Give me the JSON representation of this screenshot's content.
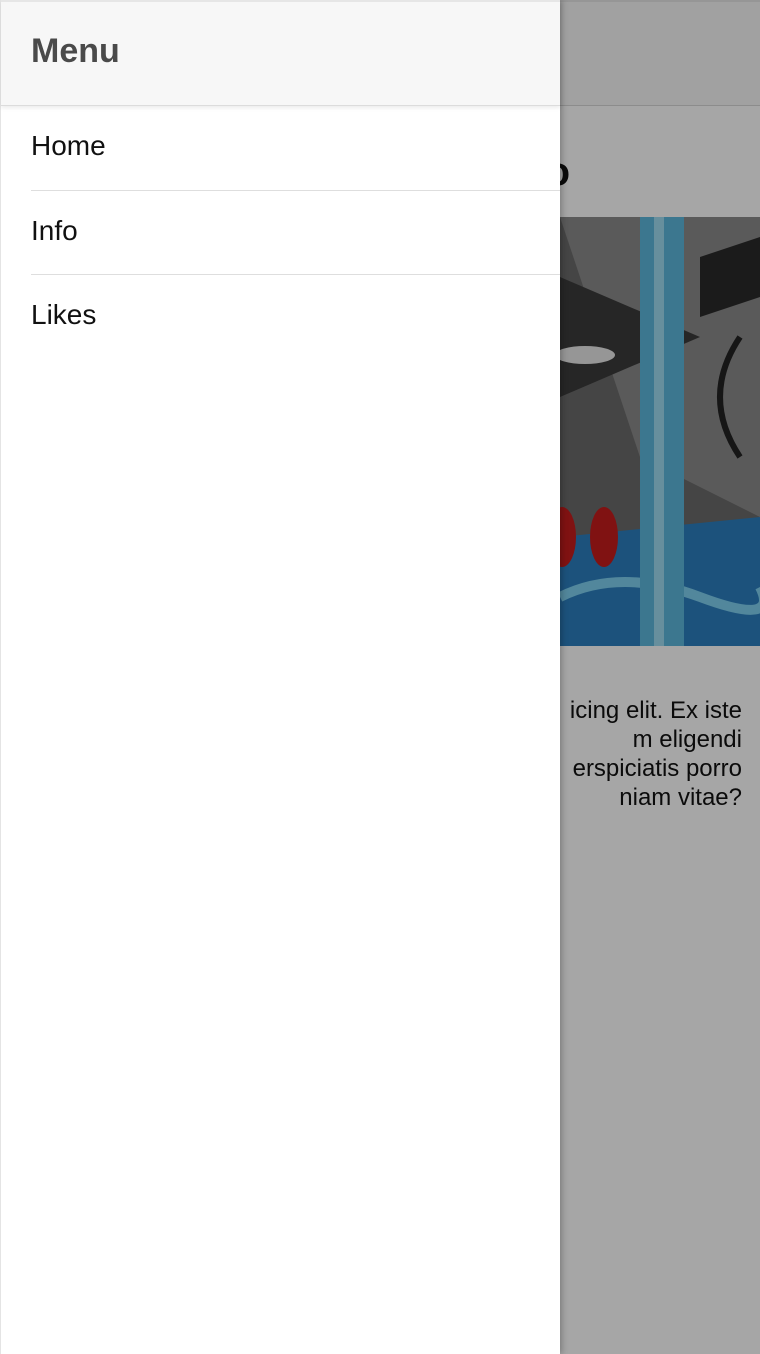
{
  "drawer": {
    "title": "Menu",
    "items": [
      {
        "label": "Home"
      },
      {
        "label": "Info"
      },
      {
        "label": "Likes"
      }
    ]
  },
  "page": {
    "title_fragment": "o",
    "body_lines": [
      "icing elit. Ex iste",
      "m eligendi",
      "erspiciatis porro",
      "niam vitae?"
    ]
  },
  "colors": {
    "header_bg": "#f7f7f7",
    "scrim": "rgba(0,0,0,0.35)",
    "text": "#111111",
    "drawer_title": "#4a4a4a"
  }
}
